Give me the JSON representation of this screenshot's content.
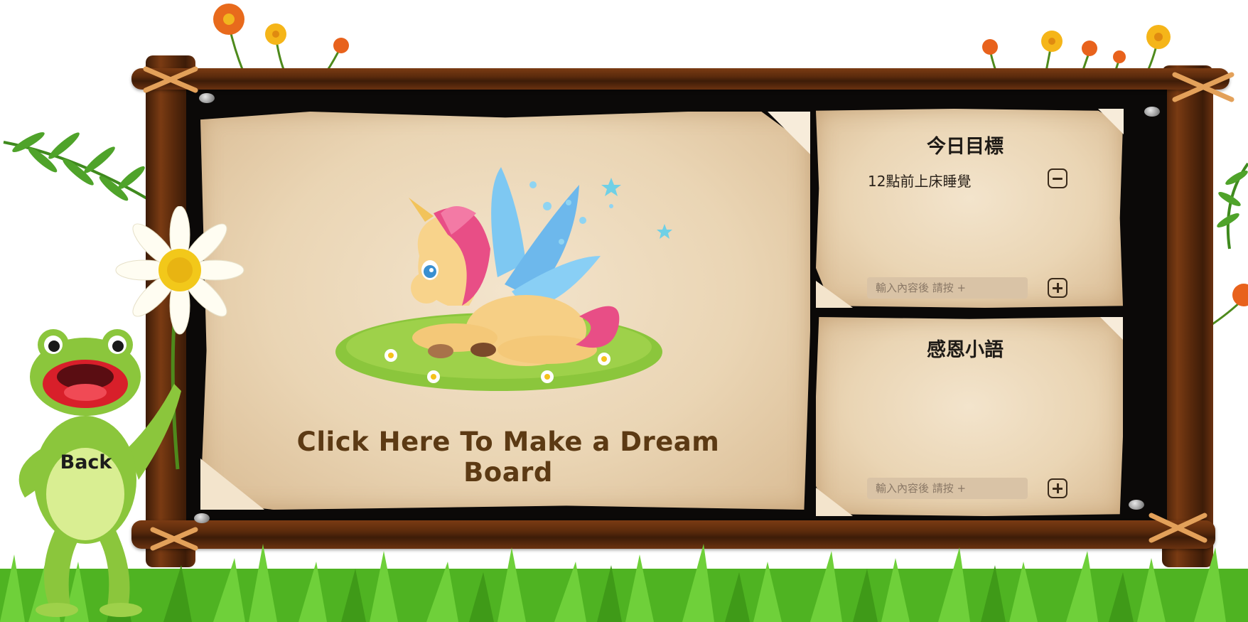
{
  "board": {
    "cta_text": "Click Here To Make a Dream Board"
  },
  "goals": {
    "title": "今日目標",
    "items": [
      "12點前上床睡覺"
    ],
    "input_placeholder": "輸入內容後 請按 +",
    "add_icon": "plus-square-icon",
    "remove_icon": "minus-square-icon"
  },
  "gratitude": {
    "title": "感恩小語",
    "input_placeholder": "輸入內容後 請按 +",
    "add_icon": "plus-square-icon"
  },
  "back": {
    "label": "Back"
  },
  "colors": {
    "wood": "#5a2a0c",
    "board": "#0b0908",
    "parchment": "#ead5b4",
    "cta_text": "#5c3a14",
    "grass": "#5cbf2a"
  }
}
